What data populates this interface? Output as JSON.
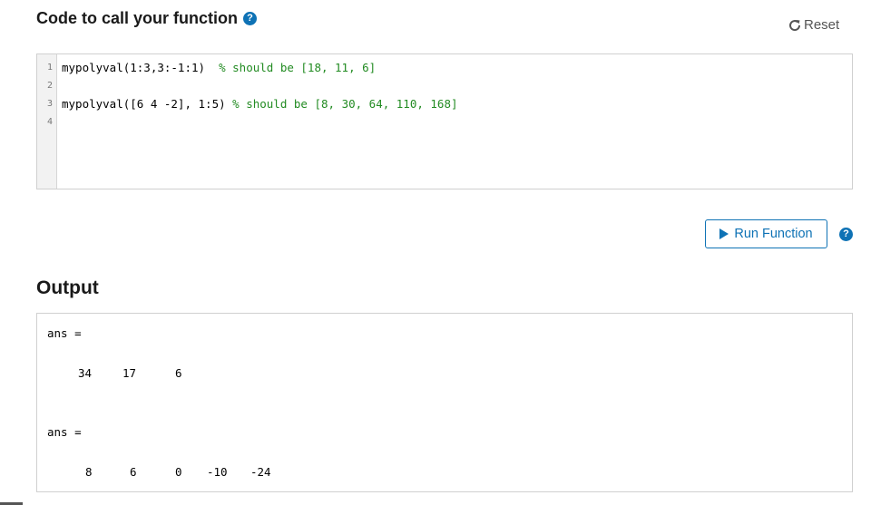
{
  "header": {
    "title": "Code to call your function",
    "help_icon": "question-circle-icon",
    "reset_label": "Reset",
    "reset_icon": "refresh-icon"
  },
  "editor": {
    "lines": [
      {
        "number": "1",
        "code": "mypolyval(1:3,3:-1:1)  ",
        "comment": "% should be [18, 11, 6]"
      },
      {
        "number": "2",
        "code": "",
        "comment": ""
      },
      {
        "number": "3",
        "code": "mypolyval([6 4 -2], 1:5) ",
        "comment": "% should be [8, 30, 64, 110, 168]"
      },
      {
        "number": "4",
        "code": "",
        "comment": ""
      }
    ]
  },
  "actions": {
    "run_label": "Run Function",
    "run_icon": "play-icon",
    "help_icon": "question-circle-icon"
  },
  "output": {
    "title": "Output",
    "blocks": [
      {
        "label": "ans =",
        "values": [
          "34",
          "17",
          "6"
        ]
      },
      {
        "label": "ans =",
        "values": [
          "8",
          "6",
          "0",
          "-10",
          "-24"
        ]
      }
    ]
  },
  "colors": {
    "accent": "#0e72b5",
    "comment": "#228b22"
  }
}
